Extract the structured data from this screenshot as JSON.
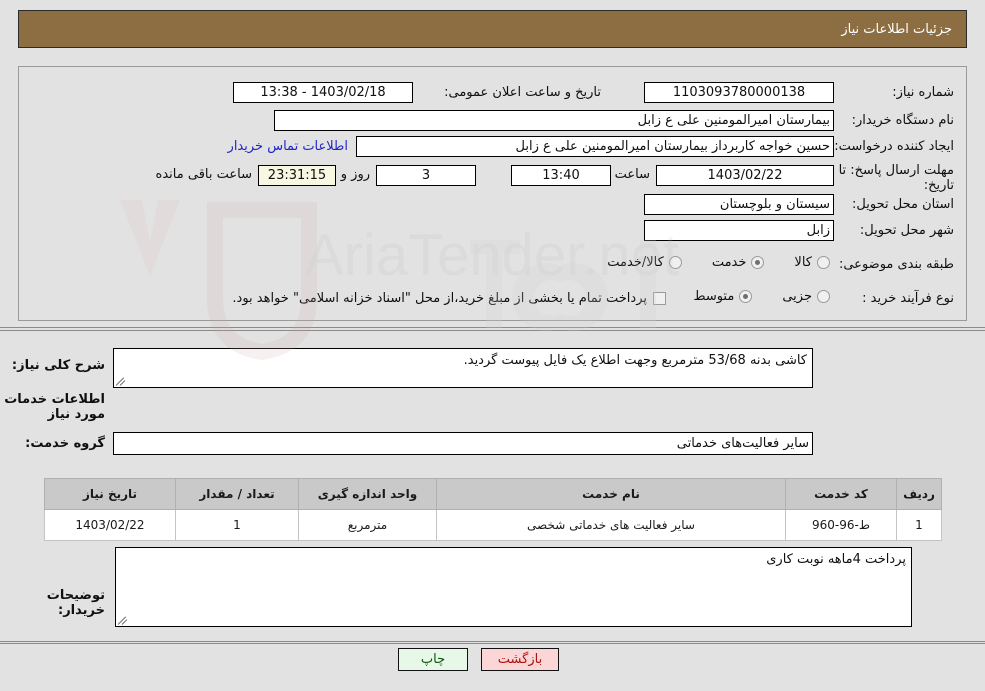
{
  "header": {
    "title": "جزئیات اطلاعات نیاز"
  },
  "form": {
    "need_number_label": "شماره نیاز:",
    "need_number_value": "1103093780000138",
    "public_announce_label": "تاریخ و ساعت اعلان عمومی:",
    "public_announce_value": "1403/02/18 - 13:38",
    "buyer_org_label": "نام دستگاه خریدار:",
    "buyer_org_value": "بیمارستان امیرالمومنین علی  ع  زابل",
    "requester_label": "ایجاد کننده درخواست:",
    "requester_value": "حسین خواجه کاربرداز بیمارستان امیرالمومنین علی  ع  زابل",
    "contact_link": "اطلاعات تماس خریدار",
    "deadline_label": "مهلت ارسال پاسخ: تا تاریخ:",
    "deadline_date": "1403/02/22",
    "deadline_hour_label": "ساعت",
    "deadline_time": "13:40",
    "days_value": "3",
    "days_label": "روز و",
    "countdown_value": "23:31:15",
    "remaining_label": "ساعت باقی مانده",
    "province_label": "استان محل تحویل:",
    "province_value": "سیستان و بلوچستان",
    "city_label": "شهر محل تحویل:",
    "city_value": "زابل",
    "category_label": "طبقه بندی موضوعی:",
    "category_options": [
      {
        "label": "کالا",
        "selected": false
      },
      {
        "label": "خدمت",
        "selected": true
      },
      {
        "label": "کالا/خدمت",
        "selected": false
      }
    ],
    "process_label": "نوع فرآیند خرید :",
    "process_options": [
      {
        "label": "جزیی",
        "selected": false
      },
      {
        "label": "متوسط",
        "selected": true
      }
    ],
    "treasury_checkbox_label": "پرداخت تمام یا بخشی از مبلغ خرید،از محل \"اسناد خزانه اسلامی\" خواهد بود.",
    "treasury_checked": false
  },
  "description": {
    "label": "شرح کلی نیاز:",
    "value": "کاشی بدنه 53/68 مترمربع وجهت اطلاع یک فایل پیوست گردید."
  },
  "services_section": {
    "heading": "اطلاعات خدمات مورد نیاز",
    "group_label": "گروه خدمت:",
    "group_value": "سایر فعالیت‌های خدماتی"
  },
  "table": {
    "columns": [
      "ردیف",
      "کد خدمت",
      "نام خدمت",
      "واحد اندازه گیری",
      "تعداد / مقدار",
      "تاریخ نیاز"
    ],
    "rows": [
      {
        "row": "1",
        "code": "ط-96-960",
        "name": "سایر فعالیت های خدماتی شخصی",
        "unit": "مترمربع",
        "qty": "1",
        "date": "1403/02/22"
      }
    ]
  },
  "buyer_notes": {
    "label": "توضیحات خریدار:",
    "value": "پرداخت 4ماهه نوبت کاری"
  },
  "footer": {
    "print_label": "چاپ",
    "back_label": "بازگشت"
  },
  "watermark": {
    "text": "AriaTender.net"
  },
  "colors": {
    "header_brown": "#8c6e42",
    "link_blue": "#2026c8",
    "countdown_bg": "#f7f7e2",
    "print_bg": "#e8f8e8",
    "back_bg": "#fbd6d6",
    "page_bg": "#e2e2e2"
  }
}
